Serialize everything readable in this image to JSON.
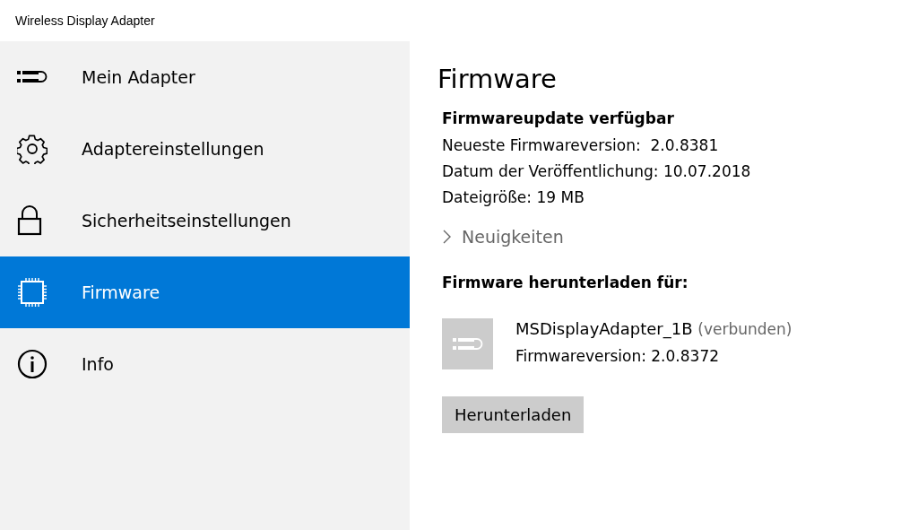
{
  "window": {
    "title": "Wireless Display Adapter"
  },
  "sidebar": {
    "items": [
      {
        "label": "Mein Adapter",
        "kind": "adapter",
        "selected": false
      },
      {
        "label": "Adaptereinstellungen",
        "kind": "gear",
        "selected": false
      },
      {
        "label": "Sicherheitseinstellungen",
        "kind": "lock",
        "selected": false
      },
      {
        "label": "Firmware",
        "kind": "chip",
        "selected": true
      },
      {
        "label": "Info",
        "kind": "info",
        "selected": false
      }
    ]
  },
  "content": {
    "title": "Firmware",
    "update": {
      "heading": "Firmwareupdate verfügbar",
      "lines": [
        "Neueste Firmwareversion:  2.0.8381",
        "Datum der Veröffentlichung: 10.07.2018",
        "Dateigröße: 19 MB"
      ]
    },
    "expander": {
      "label": "Neuigkeiten",
      "expanded": false
    },
    "download": {
      "heading": "Firmware herunterladen für:",
      "device": {
        "name": "MSDisplayAdapter_1B",
        "status": "(verbunden)",
        "version": "Firmwareversion: 2.0.8372"
      },
      "button": "Herunterladen"
    }
  }
}
